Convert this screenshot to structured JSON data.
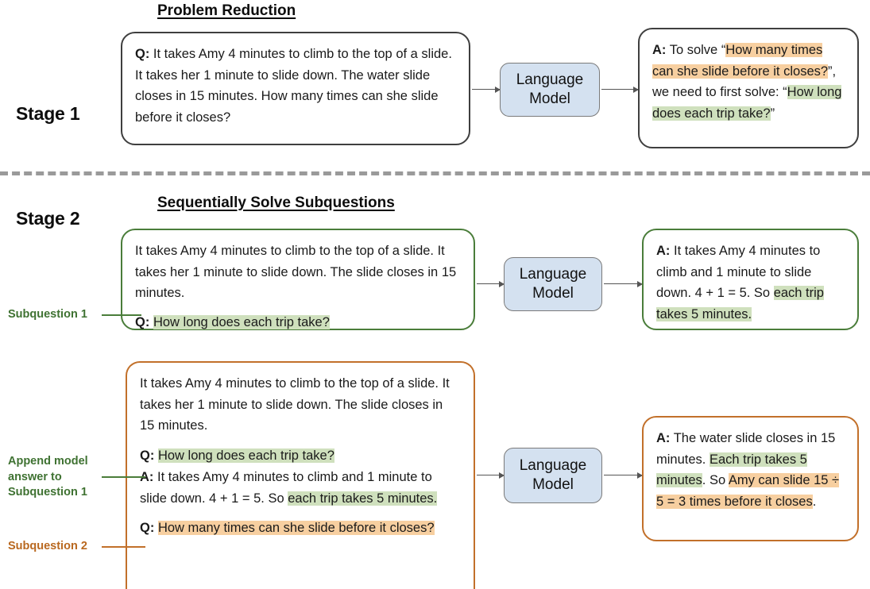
{
  "stage1": {
    "stage_label": "Stage 1",
    "heading": "Problem Reduction",
    "question_box": {
      "prefix": "Q:",
      "text": " It takes Amy 4 minutes to climb to the top of a slide. It takes her 1 minute to slide down. The water slide closes in 15 minutes. How many times can she slide before it closes?"
    },
    "model": {
      "line1": "Language",
      "line2": "Model"
    },
    "answer_box": {
      "prefix": "A:",
      "seg_1": " To solve “",
      "hl_orange_1": "How many times can she slide before it closes?",
      "seg_2": "”, we need to first solve: “",
      "hl_green_1": "How long does each trip take?",
      "seg_3": "”"
    }
  },
  "stage2": {
    "stage_label": "Stage 2",
    "heading": "Sequentially Solve Subquestions",
    "model": {
      "line1": "Language",
      "line2": "Model"
    },
    "round1": {
      "side_label": "Subquestion 1",
      "context": "It takes Amy 4 minutes to climb to the top of a slide. It takes her 1 minute to slide down. The slide closes in 15 minutes.",
      "q_prefix": "Q:",
      "q_hl_green": "How long does each trip take?",
      "answer": {
        "prefix": "A:",
        "seg_1": " It takes Amy 4 minutes to climb and 1 minute to slide down. 4 + 1 = 5. So ",
        "hl_green_1": "each trip takes 5 minutes."
      }
    },
    "round2": {
      "side_label_append": "Append model answer to Subquestion 1",
      "side_label_sub2": "Subquestion 2",
      "context": "It takes Amy 4 minutes to climb to the top of a slide. It takes her 1 minute to slide down. The slide closes in 15 minutes.",
      "q1_prefix": "Q:",
      "q1_hl_green": "How long does each trip take?",
      "a1_prefix": "A:",
      "a1_seg_1": " It takes Amy 4 minutes to climb and 1 minute to slide down. 4 + 1 = 5. So ",
      "a1_hl_green": "each trip takes 5 minutes.",
      "q2_prefix": "Q:",
      "q2_hl_orange": "How many times can she slide before it closes?",
      "answer": {
        "prefix": "A:",
        "seg_1": " The water slide closes in 15 minutes. ",
        "hl_green_1": "Each trip takes 5 minutes",
        "seg_2": ". So ",
        "hl_orange_1": "Amy can slide 15 ÷ 5 = 3 times before it closes",
        "seg_3": "."
      }
    }
  },
  "colors": {
    "green_border": "#4a7d3a",
    "orange_border": "#c2702a",
    "black_border": "#3f3f3f",
    "model_fill": "#d4e1f0",
    "highlight_green": "#cfe0bd",
    "highlight_orange": "#f7cfa0"
  }
}
